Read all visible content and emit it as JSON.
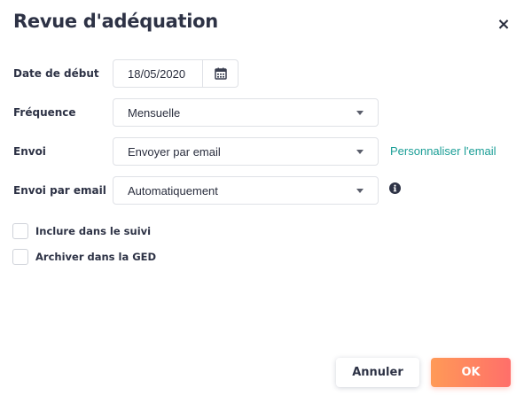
{
  "dialog": {
    "title": "Revue d'adéquation",
    "close_symbol": "×"
  },
  "form": {
    "start_date": {
      "label": "Date de début",
      "value": "18/05/2020",
      "icon": "calendar-icon"
    },
    "frequency": {
      "label": "Fréquence",
      "value": "Mensuelle"
    },
    "sending": {
      "label": "Envoi",
      "value": "Envoyer par email",
      "link_text": "Personnaliser l'email"
    },
    "email_sending": {
      "label": "Envoi par email",
      "value": "Automatiquement",
      "icon": "info-icon"
    },
    "checkboxes": [
      {
        "label": "Inclure dans le suivi",
        "checked": false
      },
      {
        "label": "Archiver dans la GED",
        "checked": false
      }
    ]
  },
  "actions": {
    "cancel_label": "Annuler",
    "ok_label": "OK"
  },
  "colors": {
    "link": "#1a9e96",
    "ok_gradient_start": "#ff9a57",
    "ok_gradient_end": "#ff6f6a",
    "text": "#2d3245"
  }
}
